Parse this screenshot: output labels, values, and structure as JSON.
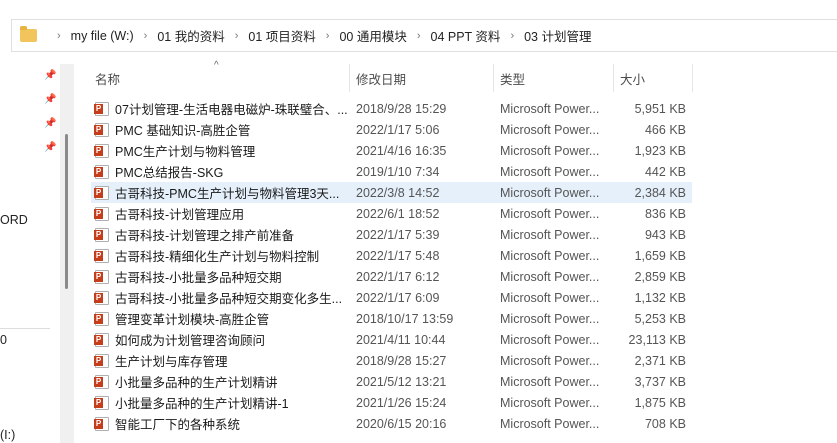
{
  "breadcrumb": [
    "my file (W:)",
    "01 我的资料",
    "01 项目资料",
    "00 通用模块",
    "04 PPT 资料",
    "03 计划管理"
  ],
  "nav": {
    "items": [
      "ORD",
      "0",
      "(I:)"
    ]
  },
  "columns": {
    "name": "名称",
    "date": "修改日期",
    "type": "类型",
    "size": "大小"
  },
  "files": [
    {
      "name": "07计划管理-生活电器电磁炉-珠联璧合、...",
      "date": "2018/9/28 15:29",
      "type": "Microsoft Power...",
      "size": "5,951 KB"
    },
    {
      "name": "PMC 基础知识-高胜企管",
      "date": "2022/1/17 5:06",
      "type": "Microsoft Power...",
      "size": "466 KB"
    },
    {
      "name": "PMC生产计划与物料管理",
      "date": "2021/4/16 16:35",
      "type": "Microsoft Power...",
      "size": "1,923 KB"
    },
    {
      "name": "PMC总结报告-SKG",
      "date": "2019/1/10 7:34",
      "type": "Microsoft Power...",
      "size": "442 KB"
    },
    {
      "name": "古哥科技-PMC生产计划与物料管理3天...",
      "date": "2022/3/8 14:52",
      "type": "Microsoft Power...",
      "size": "2,384 KB"
    },
    {
      "name": "古哥科技-计划管理应用",
      "date": "2022/6/1 18:52",
      "type": "Microsoft Power...",
      "size": "836 KB"
    },
    {
      "name": "古哥科技-计划管理之排产前准备",
      "date": "2022/1/17 5:39",
      "type": "Microsoft Power...",
      "size": "943 KB"
    },
    {
      "name": "古哥科技-精细化生产计划与物料控制",
      "date": "2022/1/17 5:48",
      "type": "Microsoft Power...",
      "size": "1,659 KB"
    },
    {
      "name": "古哥科技-小批量多品种短交期",
      "date": "2022/1/17 6:12",
      "type": "Microsoft Power...",
      "size": "2,859 KB"
    },
    {
      "name": "古哥科技-小批量多品种短交期变化多生...",
      "date": "2022/1/17 6:09",
      "type": "Microsoft Power...",
      "size": "1,132 KB"
    },
    {
      "name": "管理变革计划模块-高胜企管",
      "date": "2018/10/17 13:59",
      "type": "Microsoft Power...",
      "size": "5,253 KB"
    },
    {
      "name": "如何成为计划管理咨询顾问",
      "date": "2021/4/11 10:44",
      "type": "Microsoft Power...",
      "size": "23,113 KB"
    },
    {
      "name": "生产计划与库存管理",
      "date": "2018/9/28 15:27",
      "type": "Microsoft Power...",
      "size": "2,371 KB"
    },
    {
      "name": "小批量多品种的生产计划精讲",
      "date": "2021/5/12 13:21",
      "type": "Microsoft Power...",
      "size": "3,737 KB"
    },
    {
      "name": "小批量多品种的生产计划精讲-1",
      "date": "2021/1/26 15:24",
      "type": "Microsoft Power...",
      "size": "1,875 KB"
    },
    {
      "name": "智能工厂下的各种系统",
      "date": "2020/6/15 20:16",
      "type": "Microsoft Power...",
      "size": "708 KB"
    }
  ],
  "selected_index": 4
}
